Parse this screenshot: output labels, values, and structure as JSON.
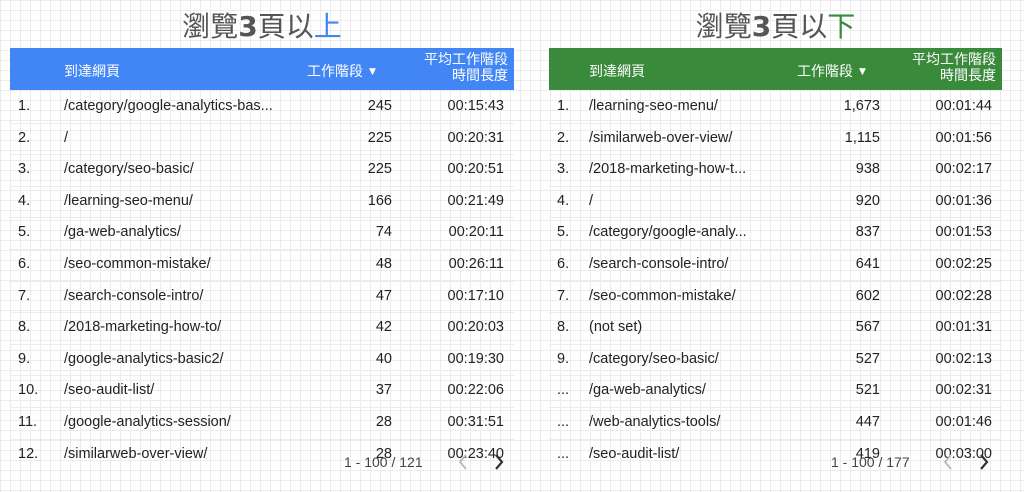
{
  "left": {
    "title_prefix": "瀏覽",
    "title_num": "3",
    "title_mid": "頁以",
    "title_suffix": "上",
    "title_suffix_color": "#4285f4",
    "header_color": "#4285f4",
    "headers": {
      "page": "到達網頁",
      "sessions": "工作階段",
      "avg_line1": "平均工作階段",
      "avg_line2": "時間長度"
    },
    "rows": [
      {
        "idx": "1.",
        "page": "/category/google-analytics-bas...",
        "sessions": "245",
        "avg": "00:15:43"
      },
      {
        "idx": "2.",
        "page": "/",
        "sessions": "225",
        "avg": "00:20:31"
      },
      {
        "idx": "3.",
        "page": "/category/seo-basic/",
        "sessions": "225",
        "avg": "00:20:51"
      },
      {
        "idx": "4.",
        "page": "/learning-seo-menu/",
        "sessions": "166",
        "avg": "00:21:49"
      },
      {
        "idx": "5.",
        "page": "/ga-web-analytics/",
        "sessions": "74",
        "avg": "00:20:11"
      },
      {
        "idx": "6.",
        "page": "/seo-common-mistake/",
        "sessions": "48",
        "avg": "00:26:11"
      },
      {
        "idx": "7.",
        "page": "/search-console-intro/",
        "sessions": "47",
        "avg": "00:17:10"
      },
      {
        "idx": "8.",
        "page": "/2018-marketing-how-to/",
        "sessions": "42",
        "avg": "00:20:03"
      },
      {
        "idx": "9.",
        "page": "/google-analytics-basic2/",
        "sessions": "40",
        "avg": "00:19:30"
      },
      {
        "idx": "10.",
        "page": "/seo-audit-list/",
        "sessions": "37",
        "avg": "00:22:06"
      },
      {
        "idx": "11.",
        "page": "/google-analytics-session/",
        "sessions": "28",
        "avg": "00:31:51"
      },
      {
        "idx": "12.",
        "page": "/similarweb-over-view/",
        "sessions": "28",
        "avg": "00:23:40"
      }
    ],
    "pagination": "1 - 100 / 121"
  },
  "right": {
    "title_prefix": "瀏覽",
    "title_num": "3",
    "title_mid": "頁以",
    "title_suffix": "下",
    "title_suffix_color": "#3a8a3c",
    "header_color": "#3a8a3c",
    "headers": {
      "page": "到達網頁",
      "sessions": "工作階段",
      "avg_line1": "平均工作階段",
      "avg_line2": "時間長度"
    },
    "rows": [
      {
        "idx": "1.",
        "page": "/learning-seo-menu/",
        "sessions": "1,673",
        "avg": "00:01:44"
      },
      {
        "idx": "2.",
        "page": "/similarweb-over-view/",
        "sessions": "1,115",
        "avg": "00:01:56"
      },
      {
        "idx": "3.",
        "page": "/2018-marketing-how-t...",
        "sessions": "938",
        "avg": "00:02:17"
      },
      {
        "idx": "4.",
        "page": "/",
        "sessions": "920",
        "avg": "00:01:36"
      },
      {
        "idx": "5.",
        "page": "/category/google-analy...",
        "sessions": "837",
        "avg": "00:01:53"
      },
      {
        "idx": "6.",
        "page": "/search-console-intro/",
        "sessions": "641",
        "avg": "00:02:25"
      },
      {
        "idx": "7.",
        "page": "/seo-common-mistake/",
        "sessions": "602",
        "avg": "00:02:28"
      },
      {
        "idx": "8.",
        "page": "(not set)",
        "sessions": "567",
        "avg": "00:01:31"
      },
      {
        "idx": "9.",
        "page": "/category/seo-basic/",
        "sessions": "527",
        "avg": "00:02:13"
      },
      {
        "idx": "...",
        "page": "/ga-web-analytics/",
        "sessions": "521",
        "avg": "00:02:31"
      },
      {
        "idx": "...",
        "page": "/web-analytics-tools/",
        "sessions": "447",
        "avg": "00:01:46"
      },
      {
        "idx": "...",
        "page": "/seo-audit-list/",
        "sessions": "419",
        "avg": "00:03:00"
      }
    ],
    "pagination": "1 - 100 / 177"
  },
  "icons": {
    "sort": "sort-desc-icon",
    "prev": "chevron-left-icon",
    "next": "chevron-right-icon"
  }
}
